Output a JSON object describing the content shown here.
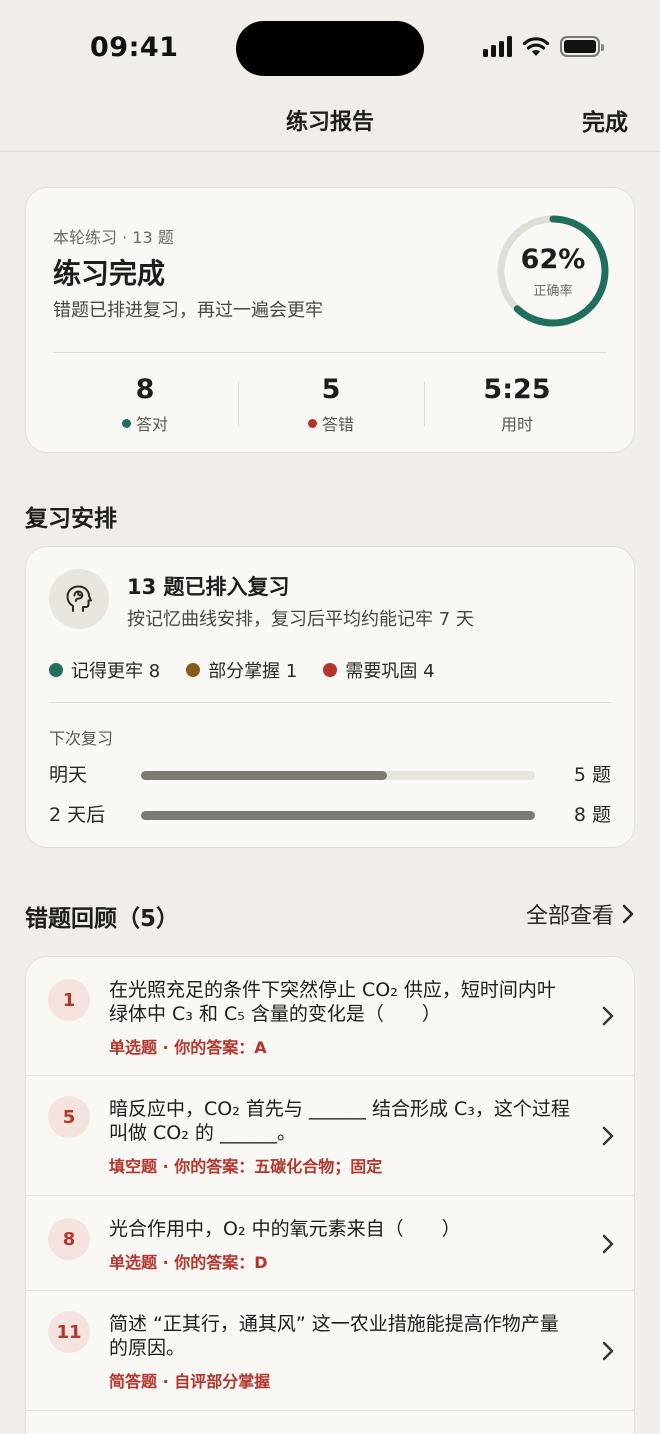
{
  "status_bar": {
    "time": "09:41"
  },
  "nav": {
    "title": "练习报告",
    "done": "完成"
  },
  "summary": {
    "meta": "本轮练习 · 13 题",
    "title": "练习完成",
    "subtitle": "错题已排进复习，再过一遍会更牢",
    "accuracy": {
      "value": "62%",
      "label": "正确率",
      "fraction": 0.62
    },
    "stats": [
      {
        "value": "8",
        "label": "答对",
        "dot_color": "#1f6f5c"
      },
      {
        "value": "5",
        "label": "答错",
        "dot_color": "#b3352c"
      },
      {
        "value": "5:25",
        "label": "用时"
      }
    ]
  },
  "review_section": {
    "title": "复习安排",
    "card_title": "13 题已排入复习",
    "card_subtitle": "按记忆曲线安排，复习后平均约能记牢 7 天",
    "legend": [
      {
        "label": "记得更牢 8",
        "color": "#1f6f5c"
      },
      {
        "label": "部分掌握 1",
        "color": "#8a5a1a"
      },
      {
        "label": "需要巩固 4",
        "color": "#b3352c"
      }
    ],
    "next_label": "下次复习",
    "schedule": [
      {
        "label": "明天",
        "count": "5 题",
        "fraction": 0.625
      },
      {
        "label": "2 天后",
        "count": "8 题",
        "fraction": 1.0
      }
    ]
  },
  "wrong_section": {
    "title": "错题回顾（5）",
    "view_all": "全部查看",
    "items": [
      {
        "num": "1",
        "text": "在光照充足的条件下突然停止 CO₂ 供应，短时间内叶绿体中 C₃ 和 C₅ 含量的变化是（　　）",
        "meta": "单选题 · 你的答案：A"
      },
      {
        "num": "5",
        "text": "暗反应中，CO₂ 首先与 ______ 结合形成 C₃，这个过程叫做 CO₂ 的 ______。",
        "meta": "填空题 · 你的答案：五碳化合物；固定"
      },
      {
        "num": "8",
        "text": "光合作用中，O₂ 中的氧元素来自（　　）",
        "meta": "单选题 · 你的答案：D"
      },
      {
        "num": "11",
        "text": "简述 “正其行，通其风” 这一农业措施能提高作物产量的原因。",
        "meta": "简答题 · 自评部分掌握"
      }
    ]
  },
  "colors": {
    "accent_green": "#1f6f5c",
    "accent_red": "#b3352c",
    "accent_brown": "#8a5a1a",
    "background": "#f1eee9",
    "card": "#f9f8f5"
  }
}
